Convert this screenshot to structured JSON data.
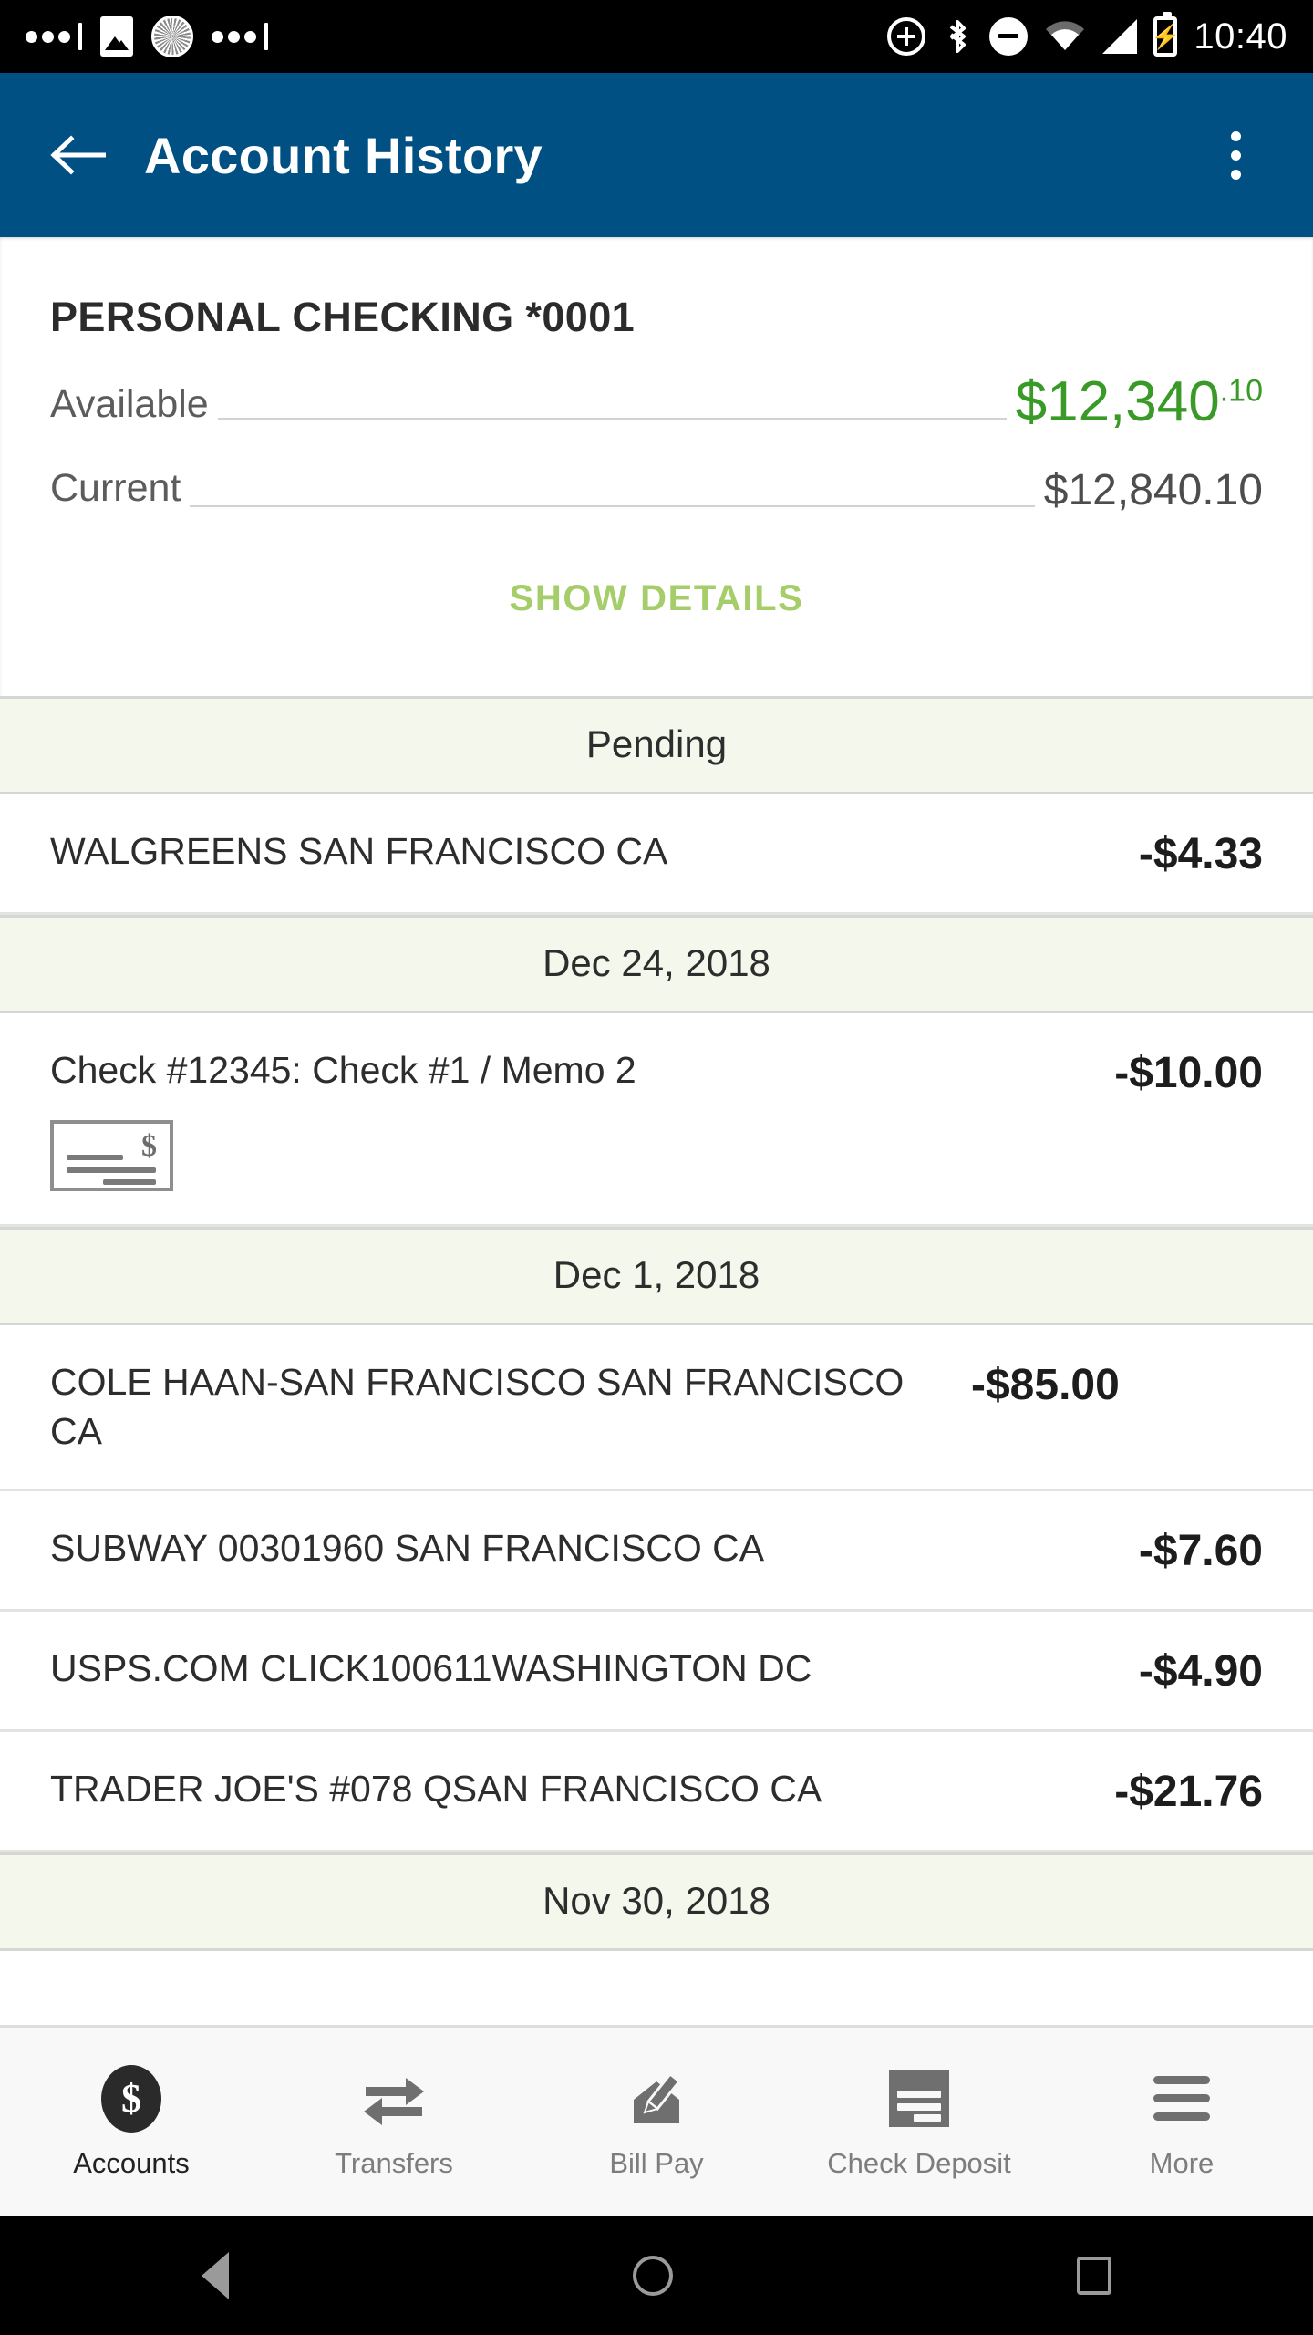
{
  "statusbar": {
    "time": "10:40",
    "left_icons": [
      "more-dots-icon",
      "photo-icon",
      "sync-spinner-icon",
      "more-dots-icon"
    ],
    "right_icons": [
      "add-circle-icon",
      "bluetooth-icon",
      "do-not-disturb-icon",
      "wifi-icon",
      "cellular-signal-icon",
      "battery-charging-icon"
    ]
  },
  "appbar": {
    "title": "Account History",
    "back_icon": "arrow-back-icon",
    "overflow_icon": "more-vertical-icon"
  },
  "account": {
    "name": "PERSONAL CHECKING *0001",
    "available_label": "Available",
    "available_amount": "$12,340",
    "available_cents": ".10",
    "current_label": "Current",
    "current_amount": "$12,840.10",
    "show_details_label": "SHOW DETAILS",
    "available_color": "#3a9a28",
    "show_details_color": "#a5ce6a"
  },
  "sections": [
    {
      "header": "Pending",
      "transactions": [
        {
          "description": "WALGREENS SAN FRANCISCO CA",
          "amount": "-$4.33",
          "has_check_image": false
        }
      ]
    },
    {
      "header": "Dec 24, 2018",
      "transactions": [
        {
          "description": "Check #12345: Check #1 / Memo 2",
          "amount": "-$10.00",
          "has_check_image": true,
          "check_icon": "check-image-icon"
        }
      ]
    },
    {
      "header": "Dec 1, 2018",
      "transactions": [
        {
          "description": "COLE HAAN-SAN FRANCISCO SAN FRANCISCO CA",
          "amount": "-$85.00",
          "has_check_image": false
        },
        {
          "description": "SUBWAY 00301960 SAN FRANCISCO CA",
          "amount": "-$7.60",
          "has_check_image": false
        },
        {
          "description": "USPS.COM CLICK100611WASHINGTON DC",
          "amount": "-$4.90",
          "has_check_image": false
        },
        {
          "description": "TRADER JOE'S #078 QSAN FRANCISCO CA",
          "amount": "-$21.76",
          "has_check_image": false
        }
      ]
    },
    {
      "header": "Nov 30, 2018",
      "transactions": []
    }
  ],
  "tabbar": {
    "items": [
      {
        "label": "Accounts",
        "icon": "dollar-coin-icon",
        "active": true
      },
      {
        "label": "Transfers",
        "icon": "transfer-arrows-icon",
        "active": false
      },
      {
        "label": "Bill Pay",
        "icon": "envelope-pen-icon",
        "active": false
      },
      {
        "label": "Check Deposit",
        "icon": "check-deposit-icon",
        "active": false
      },
      {
        "label": "More",
        "icon": "hamburger-menu-icon",
        "active": false
      }
    ]
  },
  "androidnav": {
    "back_icon": "nav-back-icon",
    "home_icon": "nav-home-icon",
    "recents_icon": "nav-recents-icon"
  }
}
